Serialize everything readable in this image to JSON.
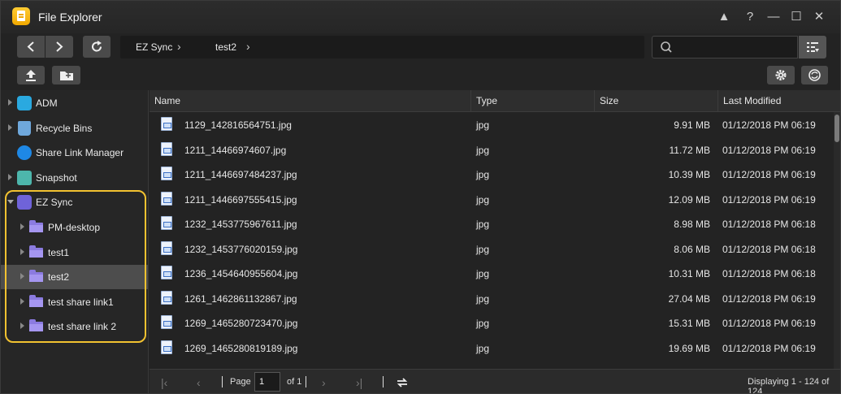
{
  "window": {
    "title": "File Explorer",
    "controls": [
      "▲",
      "?",
      "—",
      "☐",
      "✕"
    ]
  },
  "toolbar": {
    "breadcrumb": [
      "EZ Sync",
      "test2"
    ],
    "search_placeholder": "",
    "search_value": ""
  },
  "sidebar": {
    "items": [
      {
        "label": "ADM"
      },
      {
        "label": "Recycle Bins"
      },
      {
        "label": "Share Link Manager"
      },
      {
        "label": "Snapshot"
      },
      {
        "label": "EZ Sync"
      },
      {
        "label": "PM-desktop"
      },
      {
        "label": "test1"
      },
      {
        "label": "test2"
      },
      {
        "label": "test share link1"
      },
      {
        "label": "test share link 2"
      }
    ]
  },
  "table": {
    "columns": [
      "Name",
      "Type",
      "Size",
      "Last Modified"
    ],
    "rows": [
      {
        "name": "1129_142816564751.jpg",
        "type": "jpg",
        "size": "9.91 MB",
        "modified": "01/12/2018 PM 06:19"
      },
      {
        "name": "1211_14466974607.jpg",
        "type": "jpg",
        "size": "11.72 MB",
        "modified": "01/12/2018 PM 06:19"
      },
      {
        "name": "1211_1446697484237.jpg",
        "type": "jpg",
        "size": "10.39 MB",
        "modified": "01/12/2018 PM 06:19"
      },
      {
        "name": "1211_1446697555415.jpg",
        "type": "jpg",
        "size": "12.09 MB",
        "modified": "01/12/2018 PM 06:19"
      },
      {
        "name": "1232_1453775967611.jpg",
        "type": "jpg",
        "size": "8.98 MB",
        "modified": "01/12/2018 PM 06:18"
      },
      {
        "name": "1232_1453776020159.jpg",
        "type": "jpg",
        "size": "8.06 MB",
        "modified": "01/12/2018 PM 06:18"
      },
      {
        "name": "1236_1454640955604.jpg",
        "type": "jpg",
        "size": "10.31 MB",
        "modified": "01/12/2018 PM 06:18"
      },
      {
        "name": "1261_1462861132867.jpg",
        "type": "jpg",
        "size": "27.04 MB",
        "modified": "01/12/2018 PM 06:19"
      },
      {
        "name": "1269_1465280723470.jpg",
        "type": "jpg",
        "size": "15.31 MB",
        "modified": "01/12/2018 PM 06:19"
      },
      {
        "name": "1269_1465280819189.jpg",
        "type": "jpg",
        "size": "19.69 MB",
        "modified": "01/12/2018 PM 06:19"
      }
    ]
  },
  "pager": {
    "page_label": "Page",
    "page_value": "1",
    "of_label": "of 1",
    "displaying": "Displaying 1 - 124 of 124"
  }
}
